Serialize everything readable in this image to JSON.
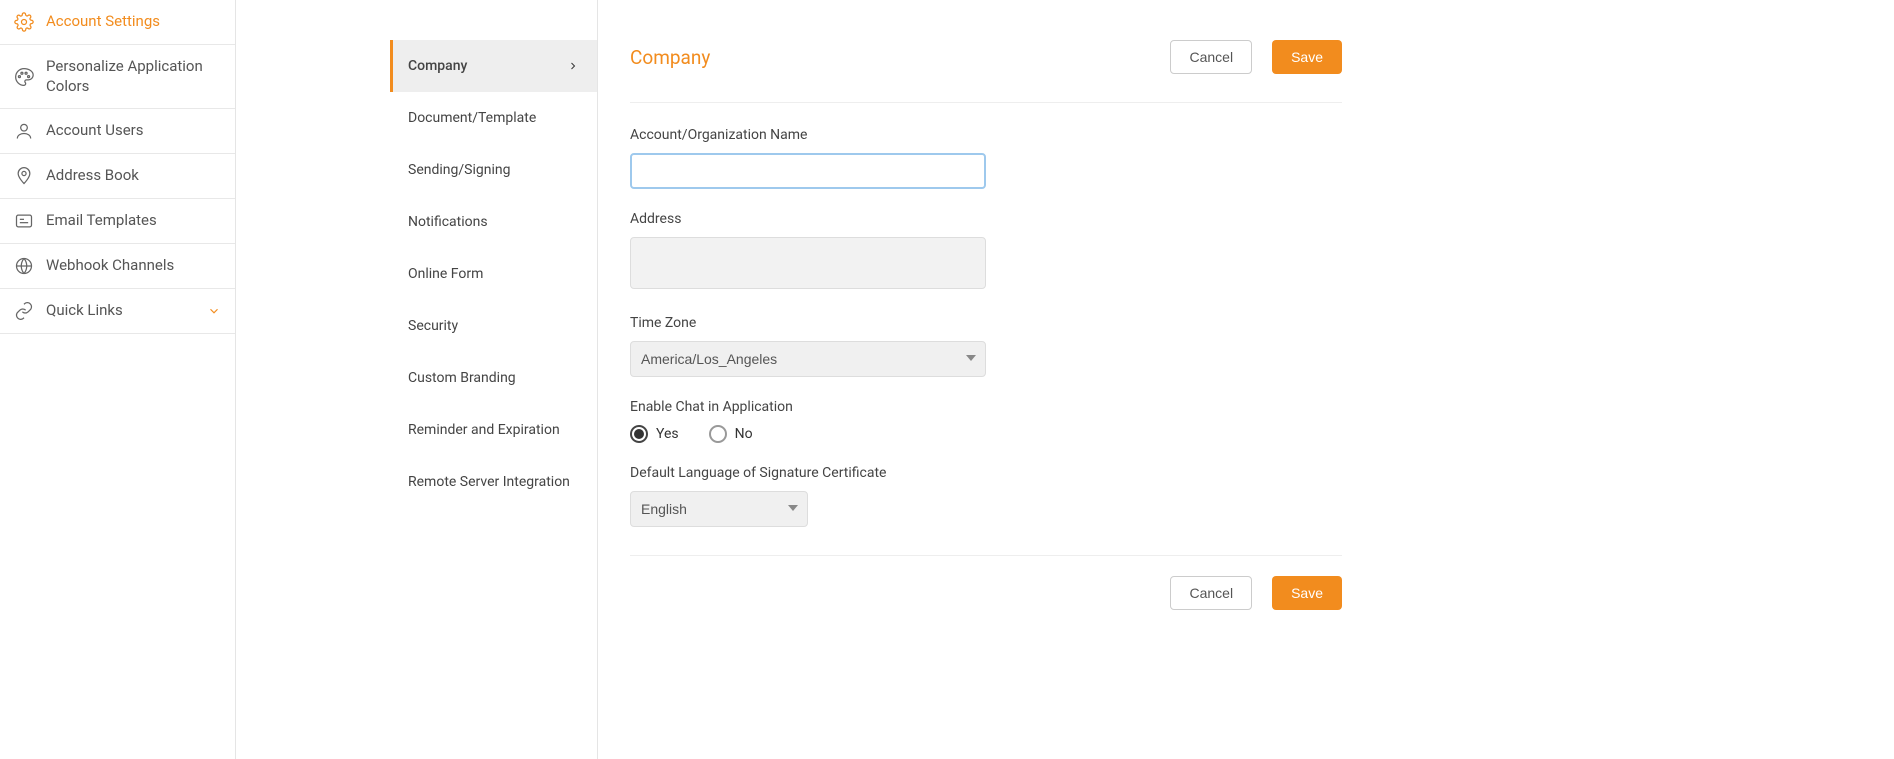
{
  "sidebar": {
    "items": [
      {
        "id": "account-settings",
        "label": "Account Settings",
        "icon": "gear",
        "active": true
      },
      {
        "id": "personalize-colors",
        "label": "Personalize Application Colors",
        "icon": "palette"
      },
      {
        "id": "account-users",
        "label": "Account Users",
        "icon": "user"
      },
      {
        "id": "address-book",
        "label": "Address Book",
        "icon": "map-pin"
      },
      {
        "id": "email-templates",
        "label": "Email Templates",
        "icon": "card"
      },
      {
        "id": "webhook-channels",
        "label": "Webhook Channels",
        "icon": "globe"
      },
      {
        "id": "quick-links",
        "label": "Quick Links",
        "icon": "link",
        "expandable": true
      }
    ]
  },
  "subnav": {
    "items": [
      {
        "id": "company",
        "label": "Company",
        "active": true
      },
      {
        "id": "doc-template",
        "label": "Document/Template"
      },
      {
        "id": "sending-signing",
        "label": "Sending/Signing"
      },
      {
        "id": "notifications",
        "label": "Notifications"
      },
      {
        "id": "online-form",
        "label": "Online Form"
      },
      {
        "id": "security",
        "label": "Security"
      },
      {
        "id": "custom-branding",
        "label": "Custom Branding"
      },
      {
        "id": "reminder-expiration",
        "label": "Reminder and Expiration"
      },
      {
        "id": "remote-server",
        "label": "Remote Server Integration"
      }
    ]
  },
  "page": {
    "title": "Company",
    "cancel_label": "Cancel",
    "save_label": "Save"
  },
  "form": {
    "org_name": {
      "label": "Account/Organization Name",
      "value": ""
    },
    "address": {
      "label": "Address",
      "value": ""
    },
    "timezone": {
      "label": "Time Zone",
      "value": "America/Los_Angeles"
    },
    "enable_chat": {
      "label": "Enable Chat in Application",
      "yes": "Yes",
      "no": "No",
      "selected": "yes"
    },
    "default_lang": {
      "label": "Default Language of Signature Certificate",
      "value": "English"
    }
  }
}
